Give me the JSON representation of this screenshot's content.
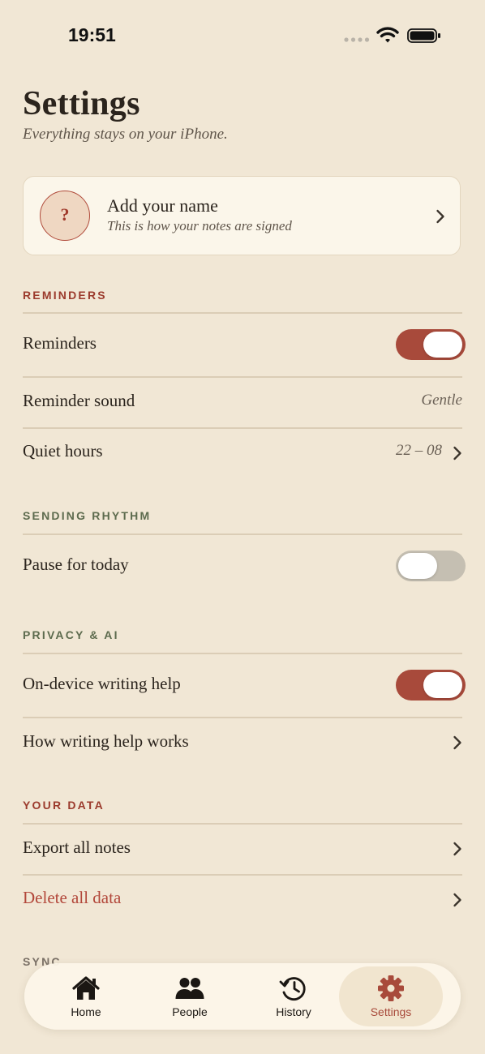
{
  "status_bar": {
    "time": "19:51"
  },
  "header": {
    "title": "Settings",
    "subtitle": "Everything stays on your iPhone."
  },
  "profile": {
    "avatar_symbol": "?",
    "name": "Add your name",
    "hint": "This is how your notes are signed"
  },
  "sections": {
    "reminders": {
      "title": "REMINDERS",
      "reminders_label": "Reminders",
      "reminders_on": true,
      "sound_label": "Reminder sound",
      "sound_value": "Gentle",
      "quiet_label": "Quiet hours",
      "quiet_value": "22 – 08"
    },
    "rhythm": {
      "title": "SENDING RHYTHM",
      "pause_label": "Pause for today",
      "pause_on": false
    },
    "privacy": {
      "title": "PRIVACY & AI",
      "help_label": "On-device writing help",
      "help_on": true,
      "how_label": "How writing help works"
    },
    "data": {
      "title": "YOUR DATA",
      "export_label": "Export all notes",
      "delete_label": "Delete all data"
    },
    "sync": {
      "title": "SYNC"
    }
  },
  "tab_bar": {
    "tabs": [
      {
        "label": "Home",
        "icon": "house-icon"
      },
      {
        "label": "People",
        "icon": "people-icon"
      },
      {
        "label": "History",
        "icon": "history-icon"
      },
      {
        "label": "Settings",
        "icon": "gear-icon"
      }
    ],
    "active": "Settings"
  },
  "colors": {
    "background": "#f1e7d5",
    "accent": "#a84a3b",
    "section_red": "#9b3a2c",
    "section_green": "#5d6b4e"
  }
}
